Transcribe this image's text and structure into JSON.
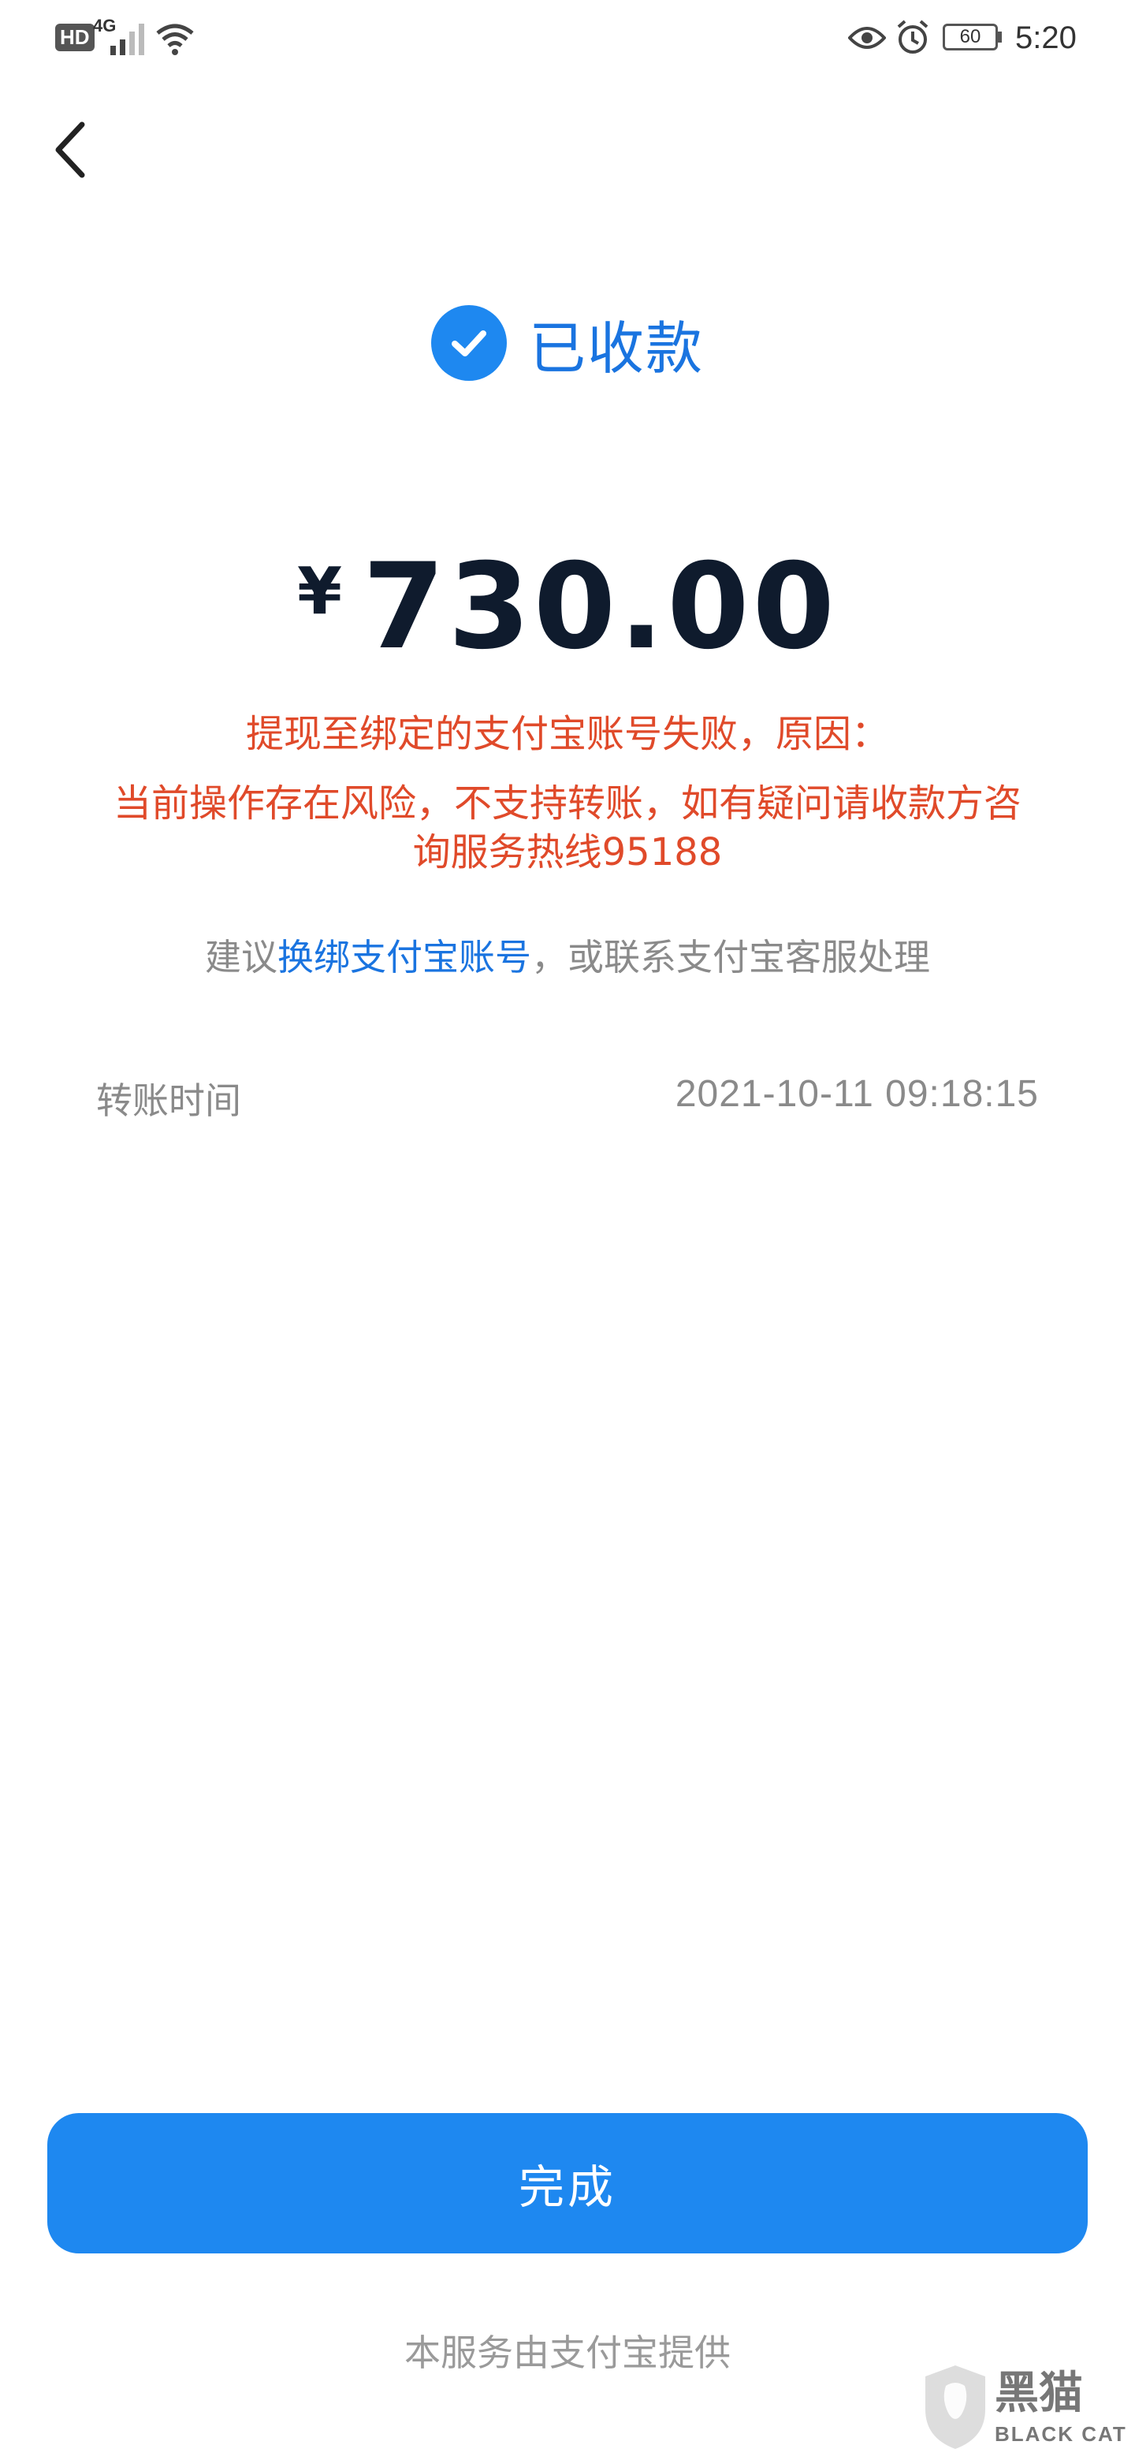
{
  "status_bar": {
    "hd": "HD",
    "network": "4G",
    "battery": "60",
    "time": "5:20"
  },
  "header": {
    "back_icon": "chevron-left-icon"
  },
  "status": {
    "icon": "check-circle-icon",
    "title": "已收款",
    "color": "#1e88f0"
  },
  "amount": {
    "currency": "¥",
    "value": "730.00"
  },
  "error": {
    "line1": "提现至绑定的支付宝账号失败，原因：",
    "line2": "当前操作存在风险，不支持转账，如有疑问请收款方咨",
    "line3": "询服务热线95188",
    "color": "#e04a2a"
  },
  "suggestion": {
    "prefix": "建议",
    "link": "换绑支付宝账号",
    "suffix": "，或联系支付宝客服处理"
  },
  "transfer_time": {
    "label": "转账时间",
    "value": "2021-10-11 09:18:15"
  },
  "done_button": {
    "label": "完成"
  },
  "footer": {
    "provider": "本服务由支付宝提供"
  },
  "watermark": {
    "cn": "黑猫",
    "en": "BLACK CAT"
  }
}
